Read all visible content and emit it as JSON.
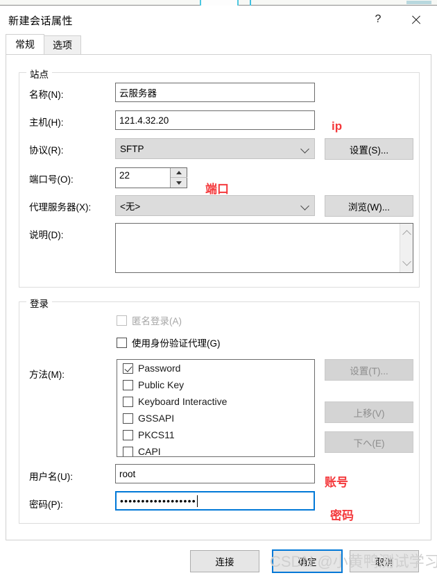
{
  "window": {
    "title": "新建会话属性",
    "help_label": "?",
    "close_label": "✕"
  },
  "tabs": [
    {
      "label": "常规",
      "active": true
    },
    {
      "label": "选项",
      "active": false
    }
  ],
  "site": {
    "group_title": "站点",
    "name_label": "名称(N):",
    "name_value": "云服务器",
    "host_label": "主机(H):",
    "host_value": "121.4.32.20",
    "protocol_label": "协议(R):",
    "protocol_value": "SFTP",
    "protocol_settings_button": "设置(S)...",
    "port_label": "端口号(O):",
    "port_value": "22",
    "proxy_label": "代理服务器(X):",
    "proxy_value": "<无>",
    "proxy_browse_button": "浏览(W)...",
    "description_label": "说明(D):",
    "description_value": ""
  },
  "login": {
    "group_title": "登录",
    "anonymous_label": "匿名登录(A)",
    "anonymous_checked": false,
    "anonymous_disabled": true,
    "agent_label": "使用身份验证代理(G)",
    "agent_checked": false,
    "method_label": "方法(M):",
    "methods": [
      {
        "label": "Password",
        "checked": true
      },
      {
        "label": "Public Key",
        "checked": false
      },
      {
        "label": "Keyboard Interactive",
        "checked": false
      },
      {
        "label": "GSSAPI",
        "checked": false
      },
      {
        "label": "PKCS11",
        "checked": false
      },
      {
        "label": "CAPI",
        "checked": false
      }
    ],
    "method_settings_button": "设置(T)...",
    "move_up_button": "上移(V)",
    "move_down_button": "下へ(E)",
    "username_label": "用户名(U):",
    "username_value": "root",
    "password_label": "密码(P):",
    "password_value": "••••••••••••••••••"
  },
  "footer": {
    "connect_button": "连接",
    "ok_button": "确定",
    "cancel_button": "取消"
  },
  "annotations": {
    "ip": "ip",
    "port": "端口",
    "account": "账号",
    "password": "密码",
    "color": "#f4393c"
  },
  "watermark": {
    "text": "CSDN @小黄鸭测试学习"
  }
}
